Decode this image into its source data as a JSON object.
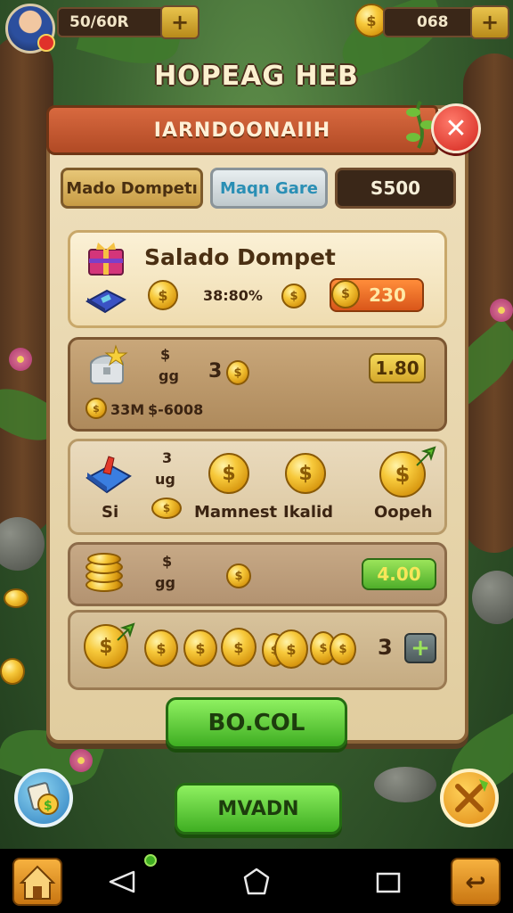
{
  "hud": {
    "currency_left": "50/60R",
    "currency_right": "068",
    "plus_label": "+"
  },
  "screen_title": "HOPEAG HEB",
  "panel": {
    "banner": "IARNDOONAIIH",
    "close_label": "✕"
  },
  "tabs": [
    {
      "label": "Mado Dompetı"
    },
    {
      "label": "Maqn Gare"
    },
    {
      "label": "S500"
    }
  ],
  "rows": {
    "r1": {
      "title": "Salado Dompet",
      "amount": "38:80%",
      "price": "230"
    },
    "r2": {
      "g_label": "$",
      "g_sub": "gg",
      "count": "3",
      "detail": "33M",
      "detail_value": "$-6008",
      "price": "1.80"
    },
    "r3": {
      "g_label": "3",
      "g_sub": "ug",
      "label_si": "Si",
      "label_a": "Mamnest",
      "label_b": "Ikalid",
      "label_c": "Oopeh"
    },
    "r4": {
      "g_label": "$",
      "g_sub": "gg",
      "price": "4.00"
    },
    "r5": {
      "count": "3",
      "plus": "+"
    }
  },
  "buttons": {
    "primary": "BO.COL",
    "secondary": "MVADN"
  },
  "nav": {
    "back_glyph": "↩"
  },
  "icons": {
    "avatar": "player-avatar",
    "gift": "gift-box-icon",
    "book": "book-icon",
    "chest": "treasure-chest-icon",
    "gem": "blue-gem-icon",
    "coins": "coin-stack-icon",
    "shop": "shop-icon",
    "spin": "spin-wheel-icon"
  },
  "colors": {
    "accent_green": "#3fae22",
    "accent_orange": "#d9561a",
    "close_red": "#d3251d",
    "coin_gold": "#f7c93b"
  }
}
